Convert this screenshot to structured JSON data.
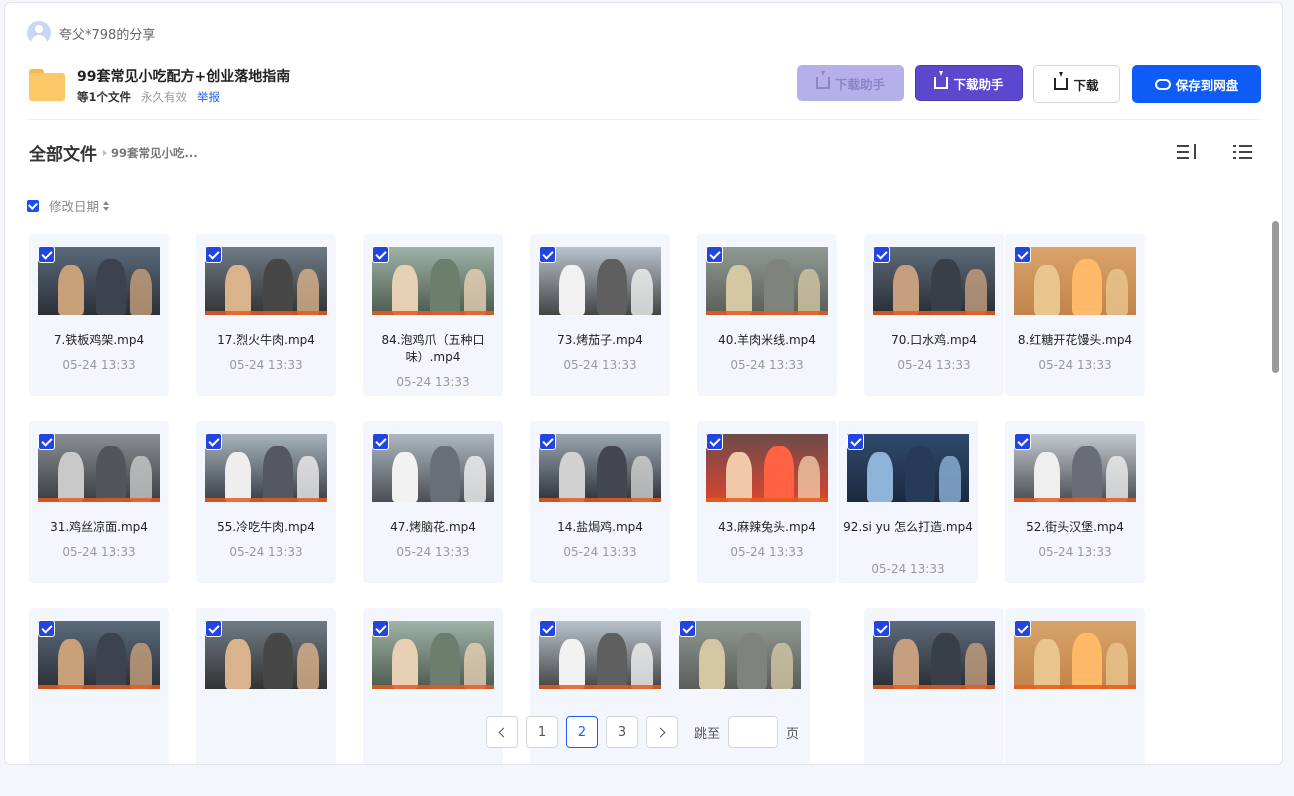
{
  "sharer": {
    "name": "夸父*798的分享"
  },
  "share": {
    "title": "99套常见小吃配方+创业落地指南",
    "file_count": "等1个文件",
    "validity": "永久有效",
    "report": "举报"
  },
  "actions": {
    "helper_light": "下载助手",
    "helper": "下载助手",
    "download": "下载",
    "save": "保存到网盘"
  },
  "breadcrumb": {
    "root": "全部文件",
    "current": "99套常见小吃..."
  },
  "sort": {
    "label": "修改日期"
  },
  "files": [
    {
      "name": "7.铁板鸡架.mp4",
      "date": "05-24 13:33"
    },
    {
      "name": "17.烈火牛肉.mp4",
      "date": "05-24 13:33"
    },
    {
      "name": "84.泡鸡爪（五种口味）.mp4",
      "date": "05-24 13:33"
    },
    {
      "name": "73.烤茄子.mp4",
      "date": "05-24 13:33"
    },
    {
      "name": "40.羊肉米线.mp4",
      "date": "05-24 13:33"
    },
    {
      "name": "70.口水鸡.mp4",
      "date": "05-24 13:33"
    },
    {
      "name": "8.红糖开花馒头.mp4",
      "date": "05-24 13:33"
    },
    {
      "name": "31.鸡丝凉面.mp4",
      "date": "05-24 13:33"
    },
    {
      "name": "55.冷吃牛肉.mp4",
      "date": "05-24 13:33"
    },
    {
      "name": "47.烤脑花.mp4",
      "date": "05-24 13:33"
    },
    {
      "name": "14.盐焗鸡.mp4",
      "date": "05-24 13:33"
    },
    {
      "name": "43.麻辣兔头.mp4",
      "date": "05-24 13:33"
    },
    {
      "name": "92.si yu 怎么打造.mp4",
      "date": "05-24 13:33"
    },
    {
      "name": "52.街头汉堡.mp4",
      "date": "05-24 13:33"
    },
    {
      "name": "",
      "date": ""
    },
    {
      "name": "",
      "date": ""
    },
    {
      "name": "",
      "date": ""
    },
    {
      "name": "",
      "date": ""
    },
    {
      "name": "",
      "date": ""
    },
    {
      "name": "",
      "date": ""
    },
    {
      "name": "",
      "date": ""
    }
  ],
  "pagination": {
    "pages": [
      "1",
      "2",
      "3"
    ],
    "current": "2",
    "jump_label": "跳至",
    "page_suffix": "页"
  },
  "colors": {
    "primary": "#0d5cf5",
    "helper": "#5b48cc",
    "folder": "#fcc766"
  }
}
